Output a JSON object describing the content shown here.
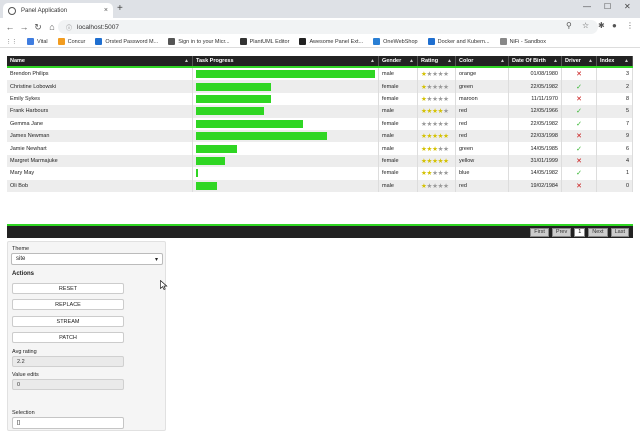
{
  "browser": {
    "tab_title": "Panel Application",
    "close_glyph": "×",
    "new_tab_glyph": "+",
    "url": "localhost:5007",
    "back_glyph": "←",
    "forward_glyph": "→",
    "reload_glyph": "↻",
    "home_glyph": "⌂",
    "bookmarks": [
      {
        "label": "Vital",
        "color": "#3f7de0"
      },
      {
        "label": "Concur",
        "color": "#f29c1f"
      },
      {
        "label": "Orsted Password M...",
        "color": "#1f6fd0"
      },
      {
        "label": "Sign in to your Micr...",
        "color": "#555555"
      },
      {
        "label": "PlantUML Editor",
        "color": "#333333"
      },
      {
        "label": "Awesome Panel Ext...",
        "color": "#222222"
      },
      {
        "label": "OneWebShop",
        "color": "#2a7fd4"
      },
      {
        "label": "Docker and Kubern...",
        "color": "#1f6fd0"
      },
      {
        "label": "NiFi - Sandbox",
        "color": "#888888"
      }
    ]
  },
  "table": {
    "columns": [
      "Name",
      "Task Progress",
      "Gender",
      "Rating",
      "Color",
      "Date Of Birth",
      "Driver",
      "Index"
    ],
    "sort_glyph": "▲",
    "rows": [
      {
        "name": "Brendon Philips",
        "progress": 100,
        "gender": "male",
        "rating": 1,
        "color": "orange",
        "dob": "01/08/1980",
        "driver": false,
        "index": "3"
      },
      {
        "name": "Christine Lobowski",
        "progress": 42,
        "gender": "female",
        "rating": 1,
        "color": "green",
        "dob": "22/05/1982",
        "driver": true,
        "index": "2"
      },
      {
        "name": "Emily Sykes",
        "progress": 42,
        "gender": "female",
        "rating": 1,
        "color": "maroon",
        "dob": "11/11/1970",
        "driver": false,
        "index": "8"
      },
      {
        "name": "Frank Harbours",
        "progress": 38,
        "gender": "male",
        "rating": 4,
        "color": "red",
        "dob": "12/05/1966",
        "driver": true,
        "index": "5"
      },
      {
        "name": "Gemma Jane",
        "progress": 60,
        "gender": "female",
        "rating": 0,
        "color": "red",
        "dob": "22/05/1982",
        "driver": true,
        "index": "7"
      },
      {
        "name": "James Newman",
        "progress": 73,
        "gender": "male",
        "rating": 5,
        "color": "red",
        "dob": "22/03/1998",
        "driver": false,
        "index": "9"
      },
      {
        "name": "Jamie Newhart",
        "progress": 23,
        "gender": "male",
        "rating": 3,
        "color": "green",
        "dob": "14/05/1985",
        "driver": true,
        "index": "6"
      },
      {
        "name": "Margret Marmajuke",
        "progress": 16,
        "gender": "female",
        "rating": 5,
        "color": "yellow",
        "dob": "31/01/1999",
        "driver": false,
        "index": "4"
      },
      {
        "name": "Mary May",
        "progress": 1,
        "gender": "female",
        "rating": 2,
        "color": "blue",
        "dob": "14/05/1982",
        "driver": true,
        "index": "1"
      },
      {
        "name": "Oli Bob",
        "progress": 12,
        "gender": "male",
        "rating": 1,
        "color": "red",
        "dob": "19/02/1984",
        "driver": false,
        "index": "0"
      }
    ],
    "driver_true_glyph": "✓",
    "driver_false_glyph": "✕",
    "pagination": {
      "first": "First",
      "prev": "Prev",
      "current": "1",
      "next": "Next",
      "last": "Last"
    }
  },
  "panel": {
    "theme_label": "Theme",
    "theme_value": "site",
    "select_arrow": "▾",
    "actions_heading": "Actions",
    "buttons": [
      "RESET",
      "REPLACE",
      "STREAM",
      "PATCH"
    ],
    "avg_rating_label": "Avg rating",
    "avg_rating_value": "2.2",
    "value_edits_label": "Value edits",
    "value_edits_value": "0",
    "selection_label": "Selection",
    "selection_value": "[]"
  },
  "colors": {
    "accent": "#2fd623",
    "header": "#222222",
    "star_on": "#d4c100",
    "tick": "#2fb52a",
    "cross": "#c81212"
  }
}
